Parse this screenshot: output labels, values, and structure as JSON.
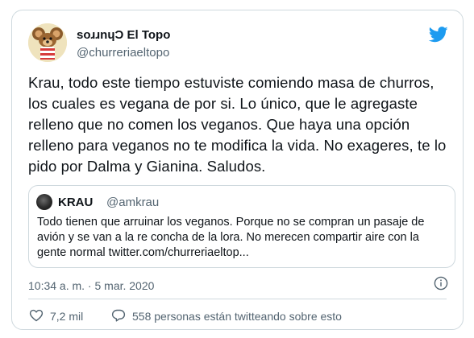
{
  "tweet": {
    "author": {
      "display_name": "soɹɹnɥƆ El Topo",
      "handle": "@churreriaeltopo",
      "avatar_icon": "mouse-mascot-avatar"
    },
    "brand_icon": "twitter-bird-icon",
    "text": "Krau, todo este tiempo estuviste comiendo masa de churros, los cuales es vegana de por si. Lo único, que le agregaste relleno que no comen los veganos. Que haya una opción relleno para veganos no te modifica la vida. No exageres, te lo pido por Dalma y Gianina. Saludos.",
    "quoted": {
      "display_name": "KRAU",
      "handle": "@amkrau",
      "text": "Todo tienen que arruinar los veganos. Porque no se compran un pasaje de avión y se van a la re concha de la lora. No merecen compartir aire con la gente normal twitter.com/churreriaeltop..."
    },
    "timestamp": "10:34 a. m. · 5 mar. 2020",
    "likes": "7,2 mil",
    "talking": "558 personas están twitteando sobre esto"
  },
  "colors": {
    "text": "#0f1419",
    "secondary": "#536471",
    "border": "#cfd9de",
    "brand": "#1d9bf0"
  }
}
